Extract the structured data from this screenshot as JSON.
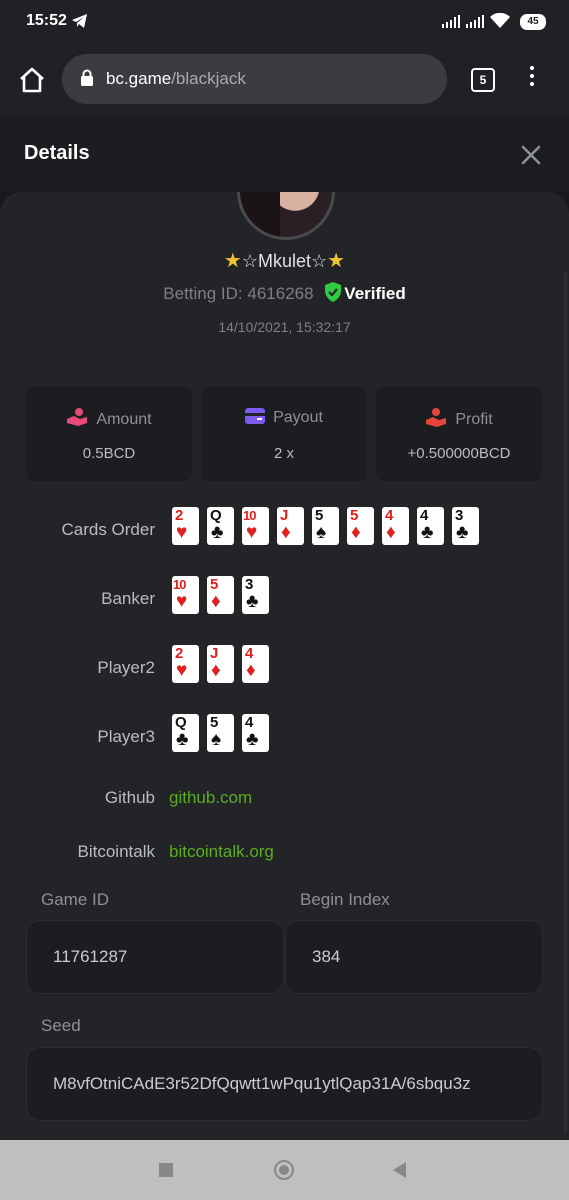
{
  "status": {
    "time": "15:52",
    "battery": "45"
  },
  "browser": {
    "url_host": "bc.game",
    "url_path": "/blackjack",
    "tab_count": "5"
  },
  "details": {
    "title": "Details"
  },
  "profile": {
    "username": "☆Mkulet☆",
    "betting_id": "Betting ID: 4616268",
    "verified": "Verified",
    "date": "14/10/2021, 15:32:17"
  },
  "stats": {
    "amount": {
      "label": "Amount",
      "value": "0.5BCD"
    },
    "payout": {
      "label": "Payout",
      "value": "2 x"
    },
    "profit": {
      "label": "Profit",
      "value": "+0.500000BCD"
    }
  },
  "rows": {
    "cards_order": {
      "label": "Cards Order",
      "cards": [
        {
          "rank": "2",
          "suit": "♥",
          "color": "red"
        },
        {
          "rank": "Q",
          "suit": "♣",
          "color": "black"
        },
        {
          "rank": "10",
          "suit": "♥",
          "color": "red"
        },
        {
          "rank": "J",
          "suit": "♦",
          "color": "red"
        },
        {
          "rank": "5",
          "suit": "♠",
          "color": "black"
        },
        {
          "rank": "5",
          "suit": "♦",
          "color": "red"
        },
        {
          "rank": "4",
          "suit": "♦",
          "color": "red"
        },
        {
          "rank": "4",
          "suit": "♣",
          "color": "black"
        },
        {
          "rank": "3",
          "suit": "♣",
          "color": "black"
        }
      ]
    },
    "banker": {
      "label": "Banker",
      "cards": [
        {
          "rank": "10",
          "suit": "♥",
          "color": "red"
        },
        {
          "rank": "5",
          "suit": "♦",
          "color": "red"
        },
        {
          "rank": "3",
          "suit": "♣",
          "color": "black"
        }
      ]
    },
    "player2": {
      "label": "Player2",
      "cards": [
        {
          "rank": "2",
          "suit": "♥",
          "color": "red"
        },
        {
          "rank": "J",
          "suit": "♦",
          "color": "red"
        },
        {
          "rank": "4",
          "suit": "♦",
          "color": "red"
        }
      ]
    },
    "player3": {
      "label": "Player3",
      "cards": [
        {
          "rank": "Q",
          "suit": "♣",
          "color": "black"
        },
        {
          "rank": "5",
          "suit": "♠",
          "color": "black"
        },
        {
          "rank": "4",
          "suit": "♣",
          "color": "black"
        }
      ]
    }
  },
  "links": {
    "github": {
      "label": "Github",
      "text": "github.com"
    },
    "bitcointalk": {
      "label": "Bitcointalk",
      "text": "bitcointalk.org"
    }
  },
  "fields": {
    "game_id": {
      "label": "Game ID",
      "value": "11761287"
    },
    "begin_index": {
      "label": "Begin Index",
      "value": "384"
    },
    "seed": {
      "label": "Seed",
      "value": "M8vfOtniCAdE3r52DfQqwtt1wPqu1ytlQap31A/6sbqu3z"
    }
  },
  "colors": {
    "accent_green": "#5aac1f",
    "verified_green": "#2ecc40",
    "card_red": "#e0201c"
  }
}
